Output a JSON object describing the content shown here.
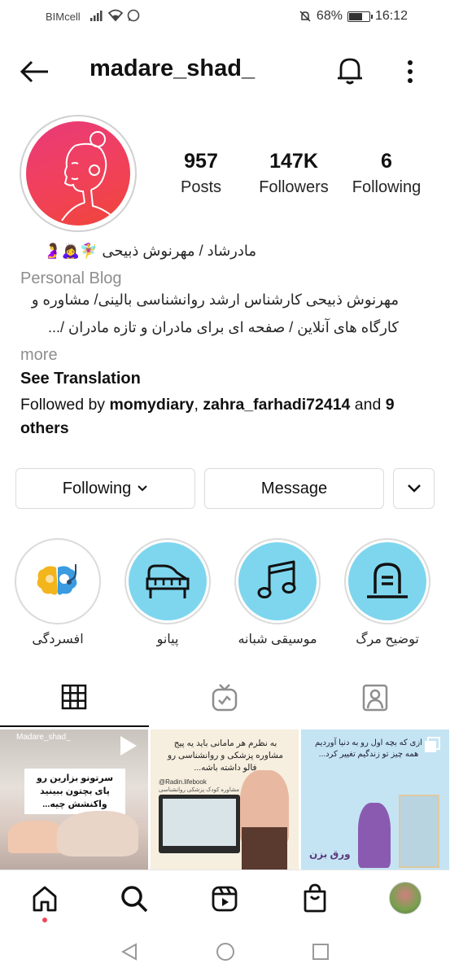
{
  "status_bar": {
    "carrier": "BIMcell",
    "battery": "68%",
    "time": "16:12"
  },
  "header": {
    "username": "madare_shad_"
  },
  "stats": {
    "posts_count": "957",
    "posts_label": "Posts",
    "followers_count": "147K",
    "followers_label": "Followers",
    "following_count": "6",
    "following_label": "Following"
  },
  "bio": {
    "name_line": "مادرشاد / مهرنوش ذبیحی 🧚‍♀️🙇‍♀️🤰",
    "category": "Personal Blog",
    "line1": "مهرنوش ذبیحی کارشناس ارشد روانشناسی بالینی/ مشاوره و",
    "line2": "کارگاه های آنلاین /  صفحه ای برای مادران و تازه مادران /...",
    "more": "more",
    "see_translation": "See Translation",
    "followed_by_prefix": "Followed by ",
    "followed_user1": "momydiary",
    "followed_sep": ", ",
    "followed_user2": "zahra_farhadi72414",
    "followed_and": " and ",
    "followed_others": "9 others"
  },
  "actions": {
    "following_label": "Following",
    "message_label": "Message"
  },
  "highlights": [
    {
      "label": "افسردگی",
      "icon": "brain-doctor-icon"
    },
    {
      "label": "پیانو",
      "icon": "piano-icon"
    },
    {
      "label": "موسیقی شبانه",
      "icon": "music-note-icon"
    },
    {
      "label": "توضیح مرگ",
      "icon": "tombstone-icon"
    }
  ],
  "posts": [
    {
      "watermark": "Madare_shad_",
      "caption": "سرتونو بزارین رو پای بچتون ببینید واکنشش چیه..."
    },
    {
      "caption": "به نظرم هر مامانی باید یه پیج مشاوره پزشکی و روانشناسی رو فالو داشته باشه...",
      "handle": "@Radin.lifebook",
      "sub": "مشاوره کودک پزشکی روانشناسی"
    },
    {
      "caption": "ازی که بچه اول رو به دنیا آوردیم همه چیز تو زندگیم تغییر کرد...",
      "signature": "ورق بزن"
    }
  ],
  "colors": {
    "avatar_gradient_start": "#e83a7a",
    "avatar_gradient_end": "#f0453a",
    "highlight_bg": "#7ed6ee",
    "notification_dot": "#ed4956"
  }
}
